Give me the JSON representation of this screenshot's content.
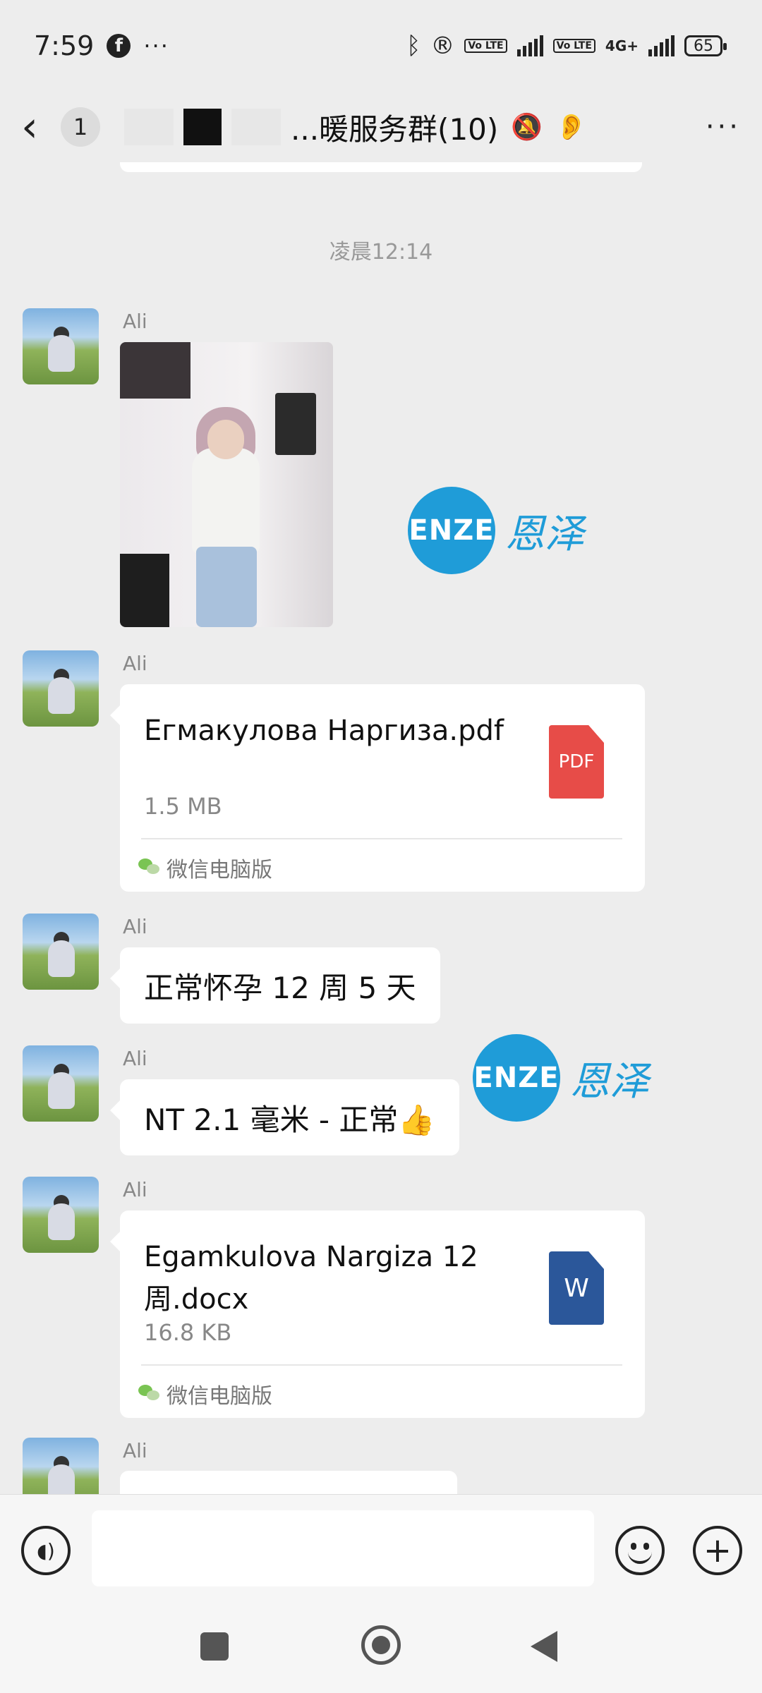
{
  "status_bar": {
    "time": "7:59",
    "left_icons": [
      "facebook-icon",
      "more-dots"
    ],
    "dots": "···",
    "fb": "f",
    "right_icons": [
      "bluetooth-icon",
      "registered-icon",
      "volte-icon",
      "signal-icon",
      "4g-icon",
      "battery-icon"
    ],
    "bluetooth": "ᛒ",
    "registered": "®",
    "volte": "Vo LTE",
    "network": "4G+",
    "battery": "65"
  },
  "header": {
    "back_glyph": "‹",
    "unread_count": "1",
    "title": "...暖服务群(10)",
    "mute_glyph": "🔕",
    "ear_glyph": "👂",
    "more_glyph": "···"
  },
  "chat": {
    "time_label": "凌晨12:14",
    "messages": [
      {
        "sender": "Ali",
        "type": "image"
      },
      {
        "sender": "Ali",
        "type": "file",
        "file_name": "Егмакулова Наргиза.pdf",
        "file_size": "1.5 MB",
        "file_icon": "PDF",
        "source": "微信电脑版"
      },
      {
        "sender": "Ali",
        "type": "text",
        "text": "正常怀孕 12 周 5 天"
      },
      {
        "sender": "Ali",
        "type": "text",
        "text": "NT 2.1 毫米 - 正常👍"
      },
      {
        "sender": "Ali",
        "type": "file",
        "file_name": "Egamkulova Nargiza 12 周.docx",
        "file_size": "16.8 KB",
        "file_icon": "W",
        "source": "微信电脑版"
      },
      {
        "sender": "Ali",
        "type": "text_partial"
      }
    ],
    "watermark": {
      "logo": "ENZE",
      "chinese": "恩泽",
      "color": "#1f9cd8"
    }
  },
  "input_bar": {
    "voice_glyph": "◖)",
    "plus_glyph": "+"
  },
  "colors": {
    "background": "#ededed",
    "bubble": "#ffffff",
    "pdf_red": "#e74c48",
    "word_blue": "#2b579a"
  }
}
